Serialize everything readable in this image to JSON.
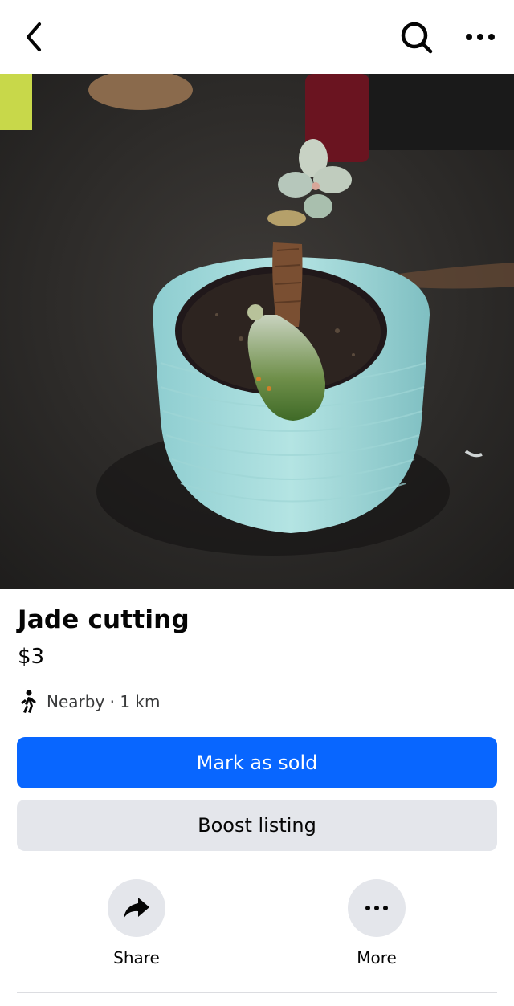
{
  "listing": {
    "title": "Jade cutting",
    "price": "$3",
    "location": "Nearby · 1 km"
  },
  "actions": {
    "primary": "Mark as sold",
    "secondary": "Boost listing",
    "share": "Share",
    "more": "More"
  },
  "icons": {
    "back": "chevron-left-icon",
    "search": "search-icon",
    "overflow": "more-horizontal-icon",
    "walk": "walking-person-icon",
    "share": "share-arrow-icon",
    "more": "more-horizontal-icon"
  },
  "colors": {
    "primary": "#0866ff",
    "secondary": "#e4e6eb"
  }
}
